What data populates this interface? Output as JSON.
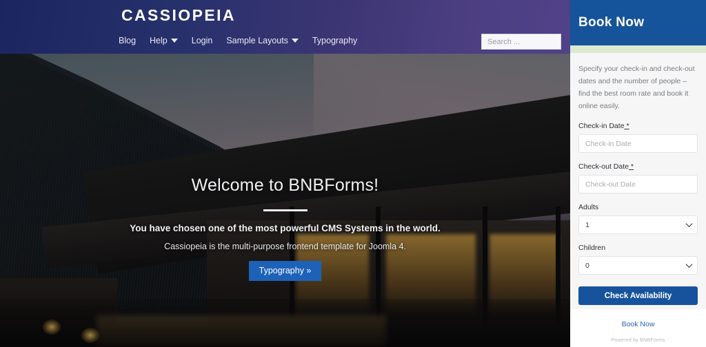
{
  "header": {
    "logo": "CASSIOPEIA",
    "nav": [
      {
        "label": "Blog",
        "has_caret": false
      },
      {
        "label": "Help",
        "has_caret": true
      },
      {
        "label": "Login",
        "has_caret": false
      },
      {
        "label": "Sample Layouts",
        "has_caret": true
      },
      {
        "label": "Typography",
        "has_caret": false
      }
    ],
    "search_placeholder": "Search ...",
    "search_value": "",
    "close_icon": "close-icon",
    "home_icon": "home-icon",
    "gradient_start": "#1b2660",
    "gradient_end": "#51428a"
  },
  "hero": {
    "title": "Welcome to BNBForms!",
    "subtitle_1": "You have chosen one of the most powerful CMS Systems in the world.",
    "subtitle_2": "Cassiopeia is the multi-purpose frontend template for Joomla 4.",
    "button_label": "Typography »",
    "button_color": "#1d62b8"
  },
  "panel": {
    "title": "Book Now",
    "header_color": "#15549a",
    "accent_color": "#dde9d0",
    "description": "Specify your check-in and check-out dates and the number of people – find the best room rate and book it online easily.",
    "fields": [
      {
        "label": "Check-in Date",
        "required": true,
        "type": "text",
        "value": "",
        "placeholder": "Check-in Date"
      },
      {
        "label": "Check-out Date",
        "required": true,
        "type": "text",
        "value": "",
        "placeholder": "Check-out Date"
      },
      {
        "label": "Adults",
        "required": false,
        "type": "select",
        "value": "1",
        "placeholder": ""
      },
      {
        "label": "Children",
        "required": false,
        "type": "select",
        "value": "0",
        "placeholder": ""
      }
    ],
    "submit_label": "Check Availability",
    "submit_color": "#17539c",
    "footer_link": "Book Now",
    "powered_by": "Powered by BNBForms"
  }
}
